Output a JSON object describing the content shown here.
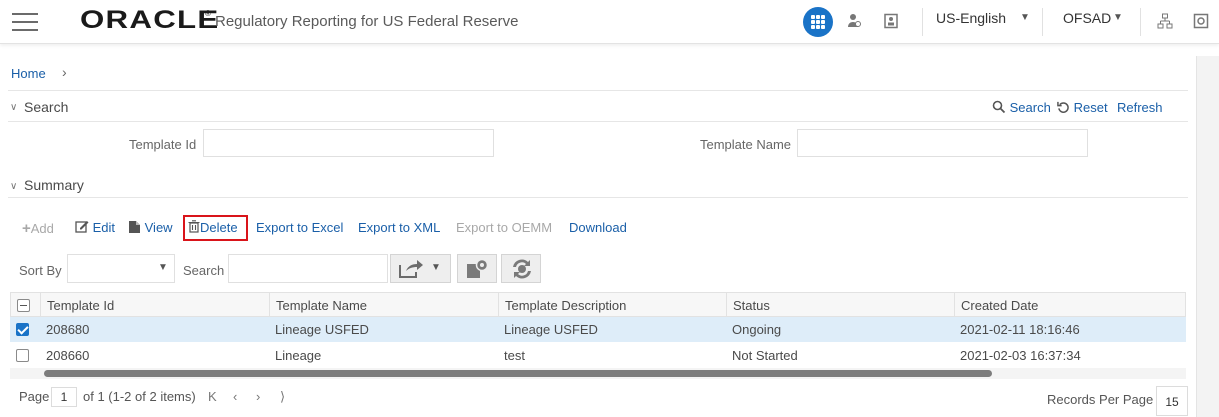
{
  "header": {
    "logo": "ORACLE",
    "logo_mark": "®",
    "app_title": "Regulatory Reporting for US Federal Reserve",
    "language": "US-English",
    "user": "OFSAD"
  },
  "breadcrumb": {
    "home": "Home",
    "separator": "›"
  },
  "search": {
    "title": "Search",
    "search_label": "Search",
    "reset_label": "Reset",
    "refresh_label": "Refresh",
    "template_id_label": "Template Id",
    "template_id_value": "",
    "template_name_label": "Template Name",
    "template_name_value": ""
  },
  "summary": {
    "title": "Summary",
    "actions": {
      "add": "Add",
      "edit": "Edit",
      "view": "View",
      "delete": "Delete",
      "export_excel": "Export to Excel",
      "export_xml": "Export to XML",
      "export_oemm": "Export to OEMM",
      "download": "Download"
    },
    "sort_by_label": "Sort By",
    "sort_by_value": "",
    "search_label": "Search",
    "search_value": ""
  },
  "grid": {
    "columns": [
      "Template Id",
      "Template Name",
      "Template Description",
      "Status",
      "Created Date"
    ],
    "rows": [
      {
        "checked": true,
        "cells": [
          "208680",
          "Lineage USFED",
          "Lineage USFED",
          "Ongoing",
          "2021-02-11 18:16:46"
        ]
      },
      {
        "checked": false,
        "cells": [
          "208660",
          "Lineage",
          "test",
          "Not Started",
          "2021-02-03 16:37:34"
        ]
      }
    ]
  },
  "pager": {
    "page_label": "Page",
    "page_value": "1",
    "of_text": "of 1 (1-2 of 2 items)",
    "records_label": "Records Per Page",
    "records_value": "15"
  },
  "icons": {
    "first": "K",
    "prev": "‹",
    "next": "›",
    "last": "⟩"
  },
  "colors": {
    "accent": "#1a73c7",
    "link": "#1a5fa8",
    "highlight": "#d9141a",
    "selected_row": "#deedf9"
  }
}
